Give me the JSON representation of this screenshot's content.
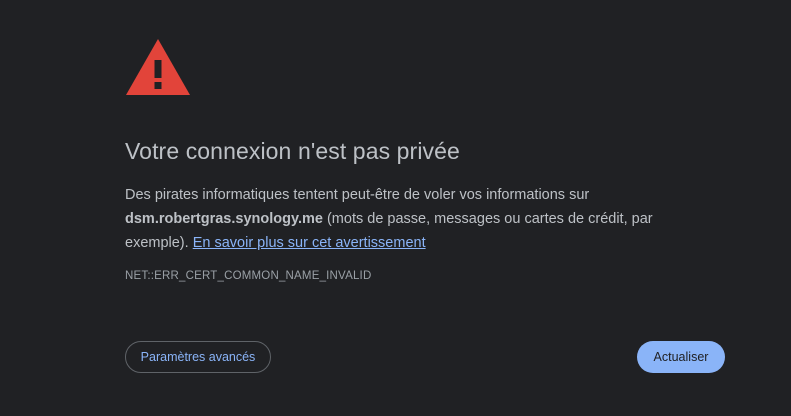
{
  "icon": "warning-triangle-icon",
  "colors": {
    "background": "#202124",
    "warning": "#e2443a",
    "text": "#bdc1c6",
    "link": "#8ab4f8",
    "muted": "#9aa0a6"
  },
  "title": "Votre connexion n'est pas privée",
  "body": {
    "intro": "Des pirates informatiques tentent peut-être de voler vos informations sur ",
    "domain": "dsm.robertgras.synology.me",
    "details": " (mots de passe, messages ou cartes de crédit, par exemple). ",
    "learn_more_link": "En savoir plus sur cet avertissement"
  },
  "error_code": "NET::ERR_CERT_COMMON_NAME_INVALID",
  "buttons": {
    "advanced_label": "Paramètres avancés",
    "reload_label": "Actualiser"
  }
}
